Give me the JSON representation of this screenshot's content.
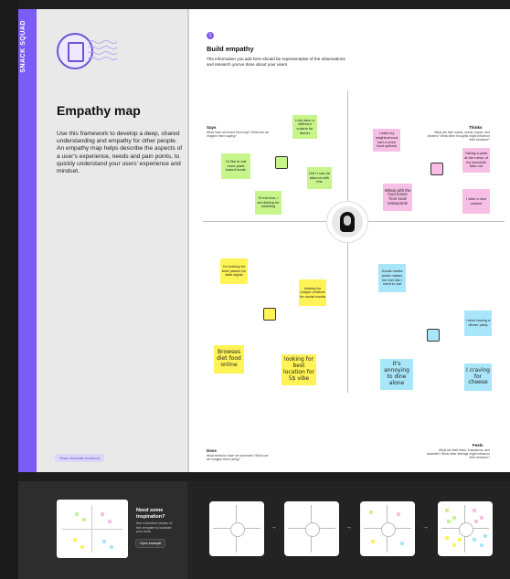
{
  "sidebar_badge": "SNACK SQUAD",
  "left": {
    "title": "Empathy map",
    "description": "Use this framework to develop a deep, shared understanding and empathy for other people. An empathy map helps describe the aspects of a user's experience, needs and pain points, to quickly understand your users' experience and mindset.",
    "feedback_label": "Share template feedback"
  },
  "canvas": {
    "step_number": "1",
    "title": "Build empathy",
    "subtitle": "The information you add here should be representative of the observations and research you've done about your users.",
    "quadrants": {
      "says": {
        "title": "Says",
        "sub": "What have we heard them say? What can we imagine them saying?"
      },
      "thinks": {
        "title": "Thinks",
        "sub": "What are their wants, needs, hopes, and dreams? What other thoughts might influence their behavior?"
      },
      "does": {
        "title": "Does",
        "sub": "What behavior have we observed? What can we imagine them doing?"
      },
      "feels": {
        "title": "Feels",
        "sub": "What are their fears, frustrations, and anxieties? What other feelings might influence their behavior?"
      }
    },
    "stickies": {
      "s1": "Lets have a different cuisine for dinner",
      "s2": "I'd like to eat more plant based foods",
      "s3": "Ooh I can do takeout with this",
      "s4": "I'll eat less, I am dieting for wedding",
      "t1": "I wish my neighborhood had a more food options",
      "t2": "Taking a peek at the menu of my favourite take out",
      "t3": "Whats with the food boxes from local restaurants",
      "t4": "I wish a new cuisine",
      "d1": "I'm looking for best places for date nights",
      "d2": "looking for unique combos for social media",
      "d3": "Browses diet food online",
      "d4": "looking for best location for 5$ vibe",
      "f1": "Social media posts makes me feel like I need to eat",
      "f2": "I miss having a dinner party",
      "f3": "It's annoying to dine alone",
      "f4": "I craving for cheese"
    }
  },
  "bottom": {
    "title": "Need some inspiration?",
    "sub": "See a finished version of this template to kickstart your work.",
    "button": "Open example"
  },
  "colors": {
    "accent": "#7c5cf6",
    "green": "#c7f58b",
    "pink": "#f7bfe6",
    "yellow": "#fff357",
    "blue": "#a9e6f9"
  }
}
